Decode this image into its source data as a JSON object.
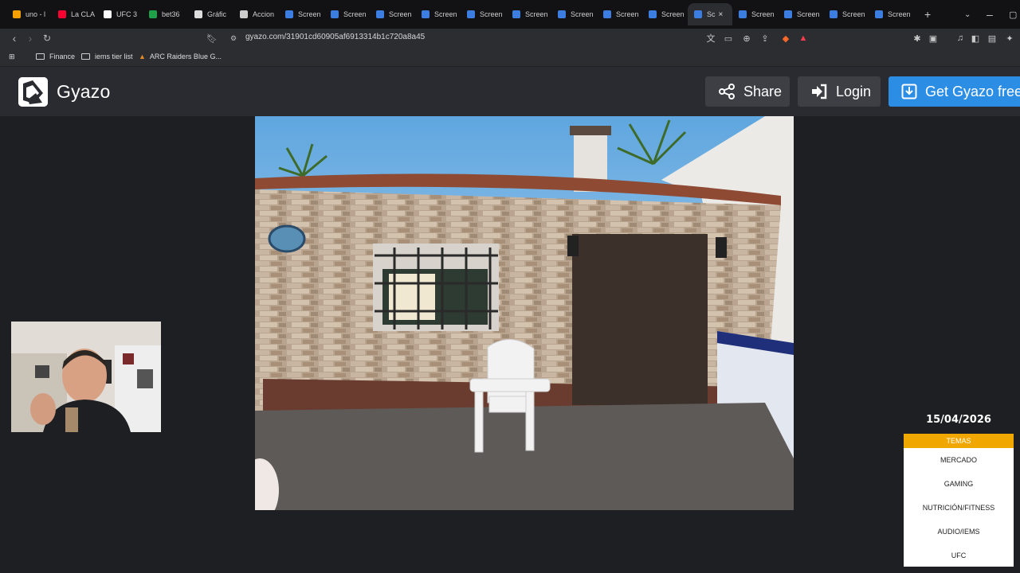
{
  "browser": {
    "tabs": [
      {
        "label": "uno - l",
        "favicon_color": "#f5a000"
      },
      {
        "label": "La CLA",
        "favicon_color": "#ff0033"
      },
      {
        "label": "UFC 3",
        "favicon_color": "#ffffff"
      },
      {
        "label": "bet36",
        "favicon_color": "#1fa14a"
      },
      {
        "label": "Gráfic",
        "favicon_color": "#dddddd"
      },
      {
        "label": "Accion",
        "favicon_color": "#cccccc"
      },
      {
        "label": "Screen",
        "favicon_color": "#3b7de0"
      },
      {
        "label": "Screen",
        "favicon_color": "#3b7de0"
      },
      {
        "label": "Screen",
        "favicon_color": "#3b7de0"
      },
      {
        "label": "Screen",
        "favicon_color": "#3b7de0"
      },
      {
        "label": "Screen",
        "favicon_color": "#3b7de0"
      },
      {
        "label": "Screen",
        "favicon_color": "#3b7de0"
      },
      {
        "label": "Screen",
        "favicon_color": "#3b7de0"
      },
      {
        "label": "Screen",
        "favicon_color": "#3b7de0"
      },
      {
        "label": "Screen",
        "favicon_color": "#3b7de0"
      },
      {
        "label": "Sc",
        "favicon_color": "#3b7de0",
        "active": true
      },
      {
        "label": "Screen",
        "favicon_color": "#3b7de0"
      },
      {
        "label": "Screen",
        "favicon_color": "#3b7de0"
      },
      {
        "label": "Screen",
        "favicon_color": "#3b7de0"
      },
      {
        "label": "Screen",
        "favicon_color": "#3b7de0"
      }
    ],
    "url": "gyazo.com/31901cd60905af6913314b1c720a8a45",
    "bookmarks": [
      {
        "label": "Finance",
        "icon": "folder-icon"
      },
      {
        "label": "iems tier list",
        "icon": "folder-icon"
      },
      {
        "label": "ARC Raiders Blue G...",
        "icon": "arc-raiders-icon"
      }
    ]
  },
  "gyazo": {
    "logo_text": "Gyazo",
    "share_label": "Share",
    "login_label": "Login",
    "getfree_label": "Get Gyazo free",
    "accent_color": "#2b8ee4"
  },
  "overlay": {
    "date": "15/04/2026",
    "topics_title": "TEMAS",
    "topics": [
      "MERCADO",
      "GAMING",
      "NUTRICIÓN/FITNESS",
      "AUDIO/IEMS",
      "UFC"
    ],
    "header_color": "#f0a800"
  }
}
